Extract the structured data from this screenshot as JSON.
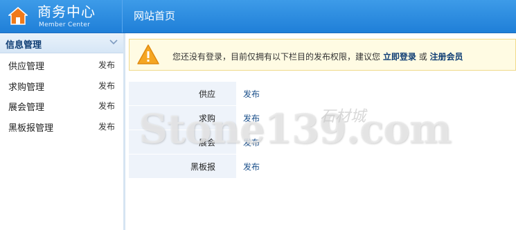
{
  "header": {
    "title": "商务中心",
    "subtitle": "Member Center",
    "nav_home": "网站首页"
  },
  "sidebar": {
    "section_label": "信息管理",
    "items": [
      {
        "label": "供应管理",
        "action": "发布"
      },
      {
        "label": "求购管理",
        "action": "发布"
      },
      {
        "label": "展会管理",
        "action": "发布"
      },
      {
        "label": "黑板报管理",
        "action": "发布"
      }
    ]
  },
  "notice": {
    "text": "您还没有登录，目前仅拥有以下栏目的发布权限，建议您",
    "login_link": "立即登录",
    "or_text": "或",
    "register_link": "注册会员"
  },
  "permissions": {
    "rows": [
      {
        "name": "供应",
        "action": "发布"
      },
      {
        "name": "求购",
        "action": "发布"
      },
      {
        "name": "展会",
        "action": "发布"
      },
      {
        "name": "黑板报",
        "action": "发布"
      }
    ]
  },
  "watermark": {
    "text": "Stone139.com",
    "text_cn": "石材城"
  },
  "colors": {
    "header_blue": "#2a8ae0",
    "sidebar_head": "#dceaf8",
    "notice_bg": "#fffbe3",
    "link_blue": "#0e3d74"
  }
}
